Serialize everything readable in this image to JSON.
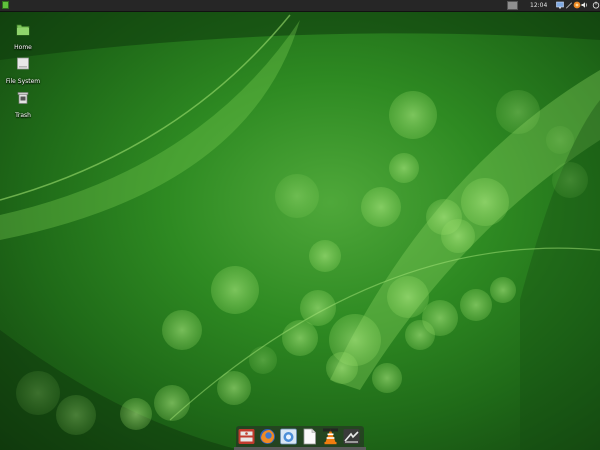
{
  "top_panel": {
    "clock": "12:04",
    "tray_icons": [
      "display-icon",
      "pen-icon",
      "update-icon",
      "volume-icon",
      "power-icon"
    ]
  },
  "desktop_icons": [
    {
      "label": "Home",
      "icon": "home-folder-icon"
    },
    {
      "label": "File System",
      "icon": "file-system-icon"
    },
    {
      "label": "Trash",
      "icon": "trash-icon"
    }
  ],
  "dock": {
    "items": [
      "bulk-rename-icon",
      "firefox-icon",
      "terminal-icon",
      "text-document-icon",
      "vlc-icon",
      "media-player-icon"
    ]
  },
  "colors": {
    "wallpaper": "#2e8a22",
    "panel": "#262626"
  }
}
